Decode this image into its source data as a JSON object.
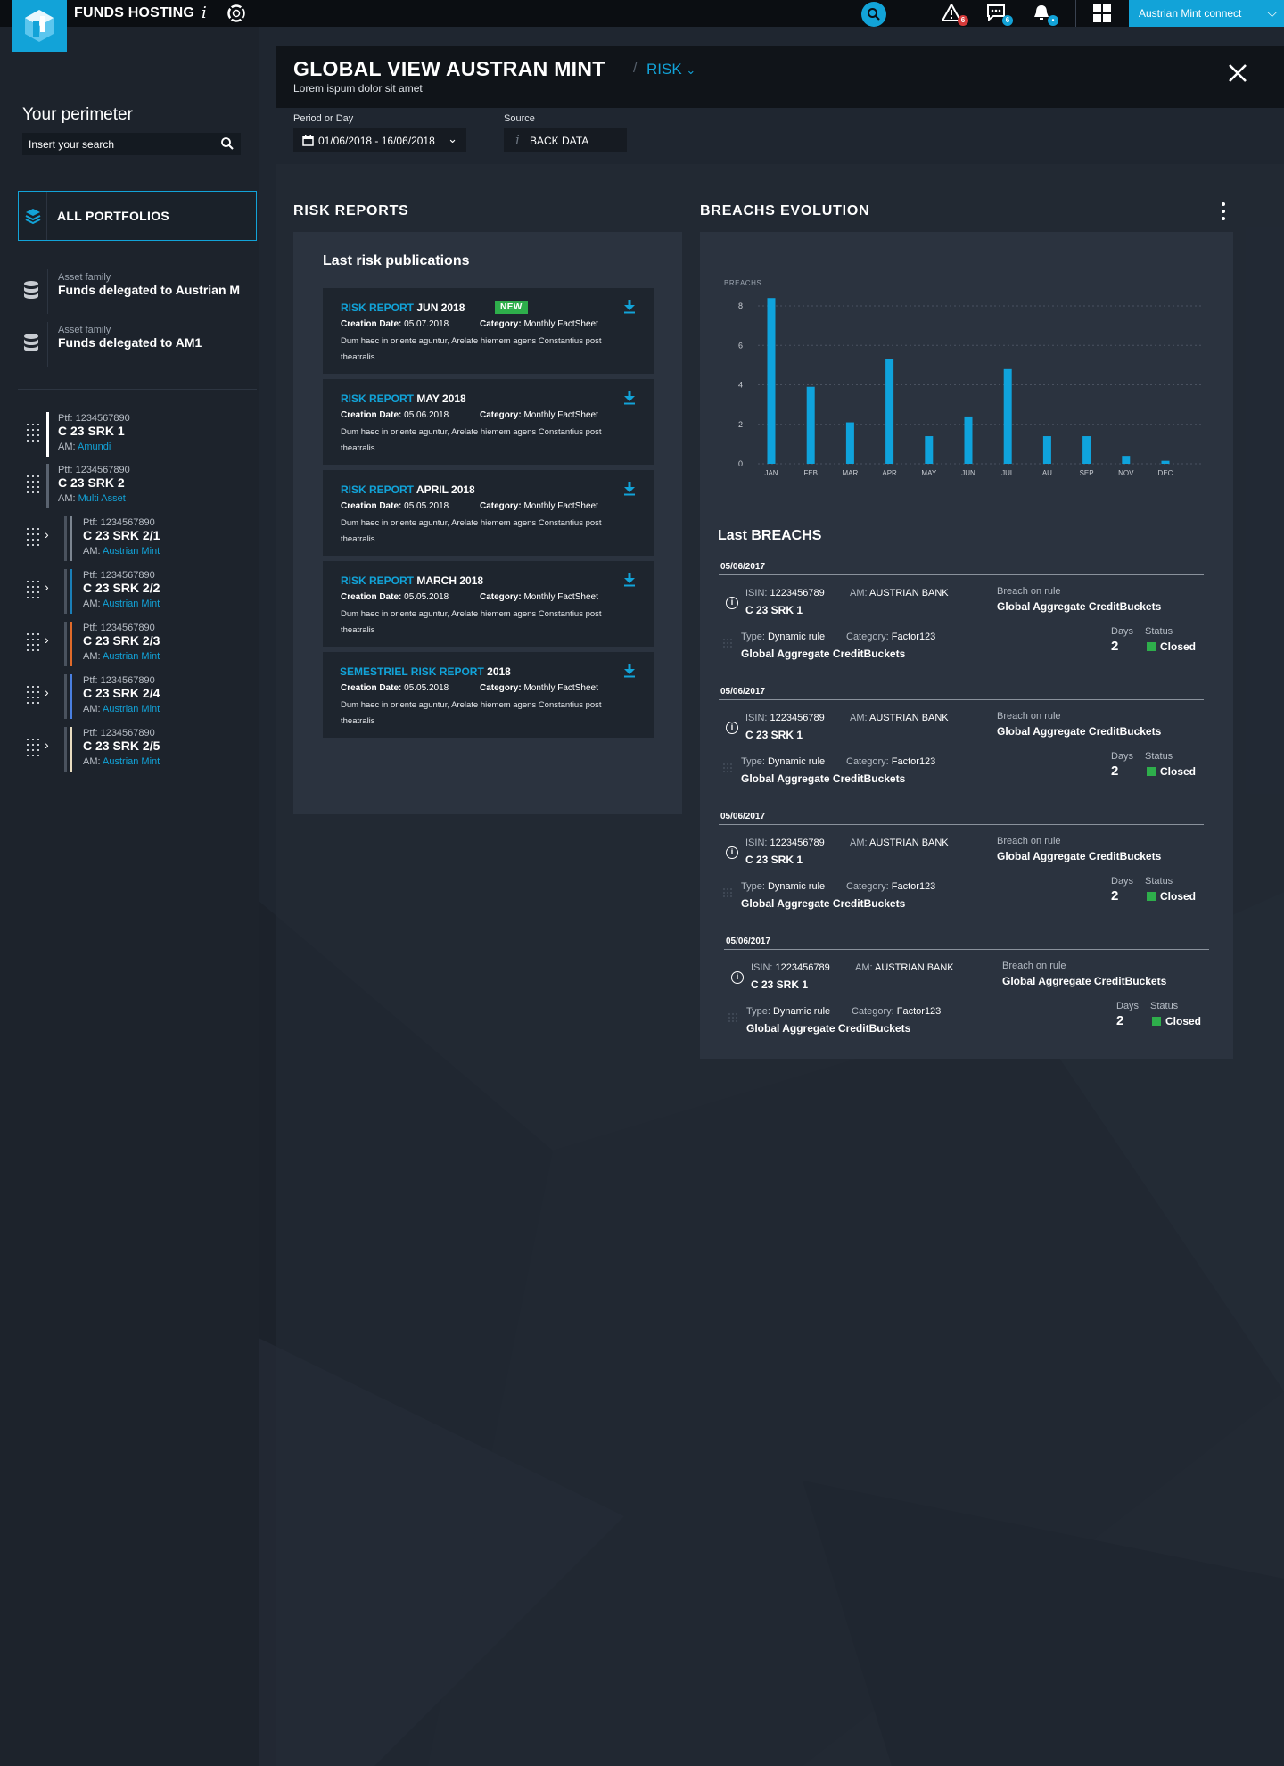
{
  "app": {
    "title": "FUNDS HOSTING",
    "info_icon": "info-icon",
    "connect_label": "Austrian Mint connect",
    "notifications": [
      {
        "name": "alert-icon",
        "count": "6",
        "color": "#d63a3a"
      },
      {
        "name": "chat-icon",
        "count": "6",
        "color": "#12a3d8"
      },
      {
        "name": "bell-icon",
        "count": "•",
        "color": "#12a3d8"
      }
    ]
  },
  "sidebar": {
    "title": "Your perimeter",
    "search_placeholder": "Insert your search",
    "all_portfolios": "ALL PORTFOLIOS",
    "asset_families": [
      {
        "label": "Asset family",
        "name": "Funds delegated to Austrian M"
      },
      {
        "label": "Asset family",
        "name": "Funds delegated to AM1"
      }
    ],
    "portfolios": [
      {
        "ptf_label": "Ptf:",
        "ptf": "1234567890",
        "name": "C 23 SRK 1",
        "am_label": "AM:",
        "am": "Amundi",
        "color": "#ffffff",
        "child": false
      },
      {
        "ptf_label": "Ptf:",
        "ptf": "1234567890",
        "name": "C 23 SRK 2",
        "am_label": "AM:",
        "am": "Multi Asset",
        "color": "#5a6370",
        "child": false
      },
      {
        "ptf_label": "Ptf:",
        "ptf": "1234567890",
        "name": "C 23 SRK 2/1",
        "am_label": "AM:",
        "am": "Austrian Mint",
        "color": "#7c8590",
        "child": true
      },
      {
        "ptf_label": "Ptf:",
        "ptf": "1234567890",
        "name": "C 23 SRK 2/2",
        "am_label": "AM:",
        "am": "Austrian Mint",
        "color": "#1a7fb8",
        "child": true
      },
      {
        "ptf_label": "Ptf:",
        "ptf": "1234567890",
        "name": "C 23 SRK 2/3",
        "am_label": "AM:",
        "am": "Austrian Mint",
        "color": "#e06a2a",
        "child": true
      },
      {
        "ptf_label": "Ptf:",
        "ptf": "1234567890",
        "name": "C 23 SRK 2/4",
        "am_label": "AM:",
        "am": "Austrian Mint",
        "color": "#4a7fe0",
        "child": true
      },
      {
        "ptf_label": "Ptf:",
        "ptf": "1234567890",
        "name": "C 23 SRK 2/5",
        "am_label": "AM:",
        "am": "Austrian Mint",
        "color": "#e8dcc0",
        "child": true
      }
    ]
  },
  "header": {
    "title": "GLOBAL VIEW AUSTRAN MINT",
    "separator": "/",
    "section": "RISK",
    "subtitle": "Lorem ispum dolor sit amet"
  },
  "filters": {
    "period_label": "Period or Day",
    "period_value": "01/06/2018 - 16/06/2018",
    "source_label": "Source",
    "source_value": "BACK DATA"
  },
  "risk_reports": {
    "section_title": "RISK REPORTS",
    "card_title": "Last risk publications",
    "items": [
      {
        "prefix": "RISK REPORT",
        "suffix": " JUN 2018",
        "is_new": true,
        "new_label": "NEW",
        "creation_label": "Creation Date:",
        "creation_date": "05.07.2018",
        "category_label": "Category:",
        "category": "Monthly FactSheet",
        "desc": "Dum haec in oriente aguntur, Arelate hiemem agens Constantius post theatralis"
      },
      {
        "prefix": "RISK REPORT",
        "suffix": " MAY 2018",
        "is_new": false,
        "creation_label": "Creation Date:",
        "creation_date": "05.06.2018",
        "category_label": "Category:",
        "category": "Monthly FactSheet",
        "desc": "Dum haec in oriente aguntur, Arelate hiemem agens Constantius post theatralis"
      },
      {
        "prefix": "RISK REPORT",
        "suffix": " APRIL 2018",
        "is_new": false,
        "creation_label": "Creation Date:",
        "creation_date": "05.05.2018",
        "category_label": "Category:",
        "category": "Monthly FactSheet",
        "desc": "Dum haec in oriente aguntur, Arelate hiemem agens Constantius post theatralis"
      },
      {
        "prefix": "RISK REPORT",
        "suffix": " MARCH 2018",
        "is_new": false,
        "creation_label": "Creation Date:",
        "creation_date": "05.05.2018",
        "category_label": "Category:",
        "category": "Monthly FactSheet",
        "desc": "Dum haec in oriente aguntur, Arelate hiemem agens Constantius post theatralis"
      },
      {
        "prefix": "SEMESTRIEL RISK REPORT",
        "suffix": " 2018",
        "is_new": false,
        "creation_label": "Creation Date:",
        "creation_date": "05.05.2018",
        "category_label": "Category:",
        "category": "Monthly FactSheet",
        "desc": "Dum haec in oriente aguntur, Arelate hiemem agens Constantius post theatralis"
      }
    ]
  },
  "breaches_evolution": {
    "section_title": "BREACHS EVOLUTION"
  },
  "chart_data": {
    "type": "bar",
    "ylabel": "BREACHS",
    "categories": [
      "JAN",
      "FEB",
      "MAR",
      "APR",
      "MAY",
      "JUN",
      "JUL",
      "AU",
      "SEP",
      "NOV",
      "DEC"
    ],
    "values": [
      8.4,
      3.9,
      2.1,
      5.3,
      1.4,
      2.4,
      4.8,
      1.4,
      1.4,
      0.4,
      0.15
    ],
    "yticks": [
      0,
      2,
      4,
      6,
      8
    ],
    "ylim": [
      0,
      8.5
    ],
    "color": "#0fa3dc",
    "grid": true
  },
  "last_breaches": {
    "title": "Last BREACHS",
    "items": [
      {
        "date": "05/06/2017",
        "isin_label": "ISIN:",
        "isin": "1223456789",
        "am_label": "AM:",
        "am": "AUSTRIAN BANK",
        "name": "C 23 SRK 1",
        "rule_label": "Breach on rule",
        "rule": "Global Aggregate CreditBuckets",
        "type_label": "Type:",
        "type": "Dynamic rule",
        "category_label": "Category:",
        "category": "Factor123",
        "bucket": "Global Aggregate CreditBuckets",
        "days_label": "Days",
        "days": "2",
        "status_label": "Status",
        "status": "Closed"
      },
      {
        "date": "05/06/2017",
        "isin_label": "ISIN:",
        "isin": "1223456789",
        "am_label": "AM:",
        "am": "AUSTRIAN BANK",
        "name": "C 23 SRK 1",
        "rule_label": "Breach on rule",
        "rule": "Global Aggregate CreditBuckets",
        "type_label": "Type:",
        "type": "Dynamic rule",
        "category_label": "Category:",
        "category": "Factor123",
        "bucket": "Global Aggregate CreditBuckets",
        "days_label": "Days",
        "days": "2",
        "status_label": "Status",
        "status": "Closed"
      },
      {
        "date": "05/06/2017",
        "isin_label": "ISIN:",
        "isin": "1223456789",
        "am_label": "AM:",
        "am": "AUSTRIAN BANK",
        "name": "C 23 SRK 1",
        "rule_label": "Breach on rule",
        "rule": "Global Aggregate CreditBuckets",
        "type_label": "Type:",
        "type": "Dynamic rule",
        "category_label": "Category:",
        "category": "Factor123",
        "bucket": "Global Aggregate CreditBuckets",
        "days_label": "Days",
        "days": "2",
        "status_label": "Status",
        "status": "Closed"
      },
      {
        "date": "05/06/2017",
        "isin_label": "ISIN:",
        "isin": "1223456789",
        "am_label": "AM:",
        "am": "AUSTRIAN BANK",
        "name": "C 23 SRK 1",
        "rule_label": "Breach on rule",
        "rule": "Global Aggregate CreditBuckets",
        "type_label": "Type:",
        "type": "Dynamic rule",
        "category_label": "Category:",
        "category": "Factor123",
        "bucket": "Global Aggregate CreditBuckets",
        "days_label": "Days",
        "days": "2",
        "status_label": "Status",
        "status": "Closed"
      }
    ]
  },
  "colors": {
    "accent": "#12a3d8",
    "success": "#2eae4b",
    "danger": "#d63a3a",
    "background": "#1f2630",
    "card": "#2b333f"
  }
}
